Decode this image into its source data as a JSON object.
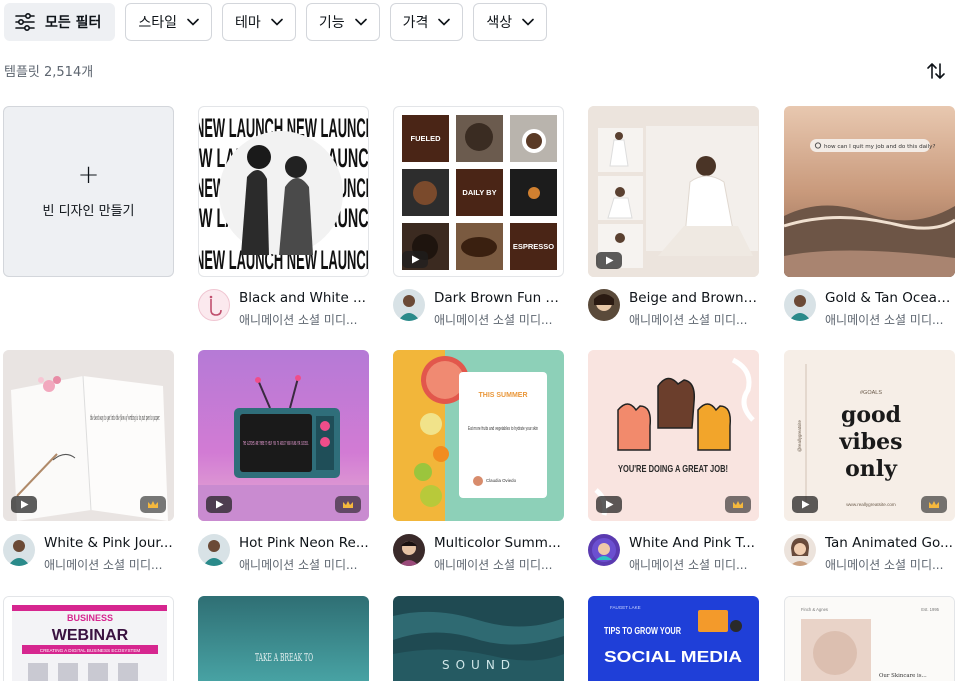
{
  "filters": {
    "all_label": "모든 필터",
    "style_label": "스타일",
    "theme_label": "테마",
    "feature_label": "기능",
    "price_label": "가격",
    "color_label": "색상"
  },
  "results": {
    "count_text": "템플릿 2,514개"
  },
  "create": {
    "plus": "+",
    "label": "빈 디자인 만들기"
  },
  "templates": [
    {
      "title": "Black and White ...",
      "author": "애니메이션 소셜 미디..."
    },
    {
      "title": "Dark Brown Fun E...",
      "author": "애니메이션 소셜 미디..."
    },
    {
      "title": "Beige and Brown ...",
      "author": "애니메이션 소셜 미디..."
    },
    {
      "title": "Gold & Tan Ocean...",
      "author": "애니메이션 소셜 미디..."
    },
    {
      "title": "White & Pink Jour...",
      "author": "애니메이션 소셜 미디..."
    },
    {
      "title": "Hot Pink Neon Re...",
      "author": "애니메이션 소셜 미디..."
    },
    {
      "title": "Multicolor Summ...",
      "author": "애니메이션 소셜 미디..."
    },
    {
      "title": "White And Pink T...",
      "author": "애니메이션 소셜 미디..."
    },
    {
      "title": "Tan Animated Go...",
      "author": "애니메이션 소셜 미디..."
    }
  ],
  "thumb_text": {
    "t1": "NEW LAUNCH NEW LAUNCH",
    "t2_a": "FUELED",
    "t2_b": "DAILY BY",
    "t2_c": "ESPRESSO",
    "t4": "how can I quit my job and do this daily?",
    "t5": "the best way to get into the flow of writing is to put pen to paper.",
    "t6": "THE GLITCHES ARE THERE TO HELP YOU TO ADJUST YOUR PLANS FOR SUCCESS.",
    "t7_a": "THIS SUMMER",
    "t7_b": "Eat more fruits and vegetables to hydrate your skin",
    "t7_c": "Claudia Oviedo",
    "t8": "YOU'RE DOING A GREAT JOB!",
    "t9_a": "#GOALS",
    "t9_b": "good",
    "t9_c": "vibes",
    "t9_d": "only",
    "t9_e": "www.reallygreatsite.com",
    "t9_f": "@reallygreatsite",
    "t10_a": "BUSINESS",
    "t10_b": "WEBINAR",
    "t10_c": "CREATING A DIGITAL BUSINESS ECOSYSTEM",
    "t11": "TAKE A BREAK TO",
    "t12": "SOUND",
    "t13_a": "FAUGET LAKE",
    "t13_b": "TIPS TO GROW YOUR",
    "t13_c": "SOCIAL MEDIA",
    "t14_a": "Finch & Agnes",
    "t14_b": "Est. 1995",
    "t14_c": "Our Skincare is..."
  },
  "colors": {
    "accent_dark": "#0e1318",
    "chip_border": "#d3d6db",
    "muted_text": "#5e6670"
  },
  "icons": {
    "filter": "sliders-icon",
    "chevron": "chevron-down-icon",
    "sort": "sort-arrows-icon",
    "play": "play-icon",
    "premium": "crown-icon"
  }
}
